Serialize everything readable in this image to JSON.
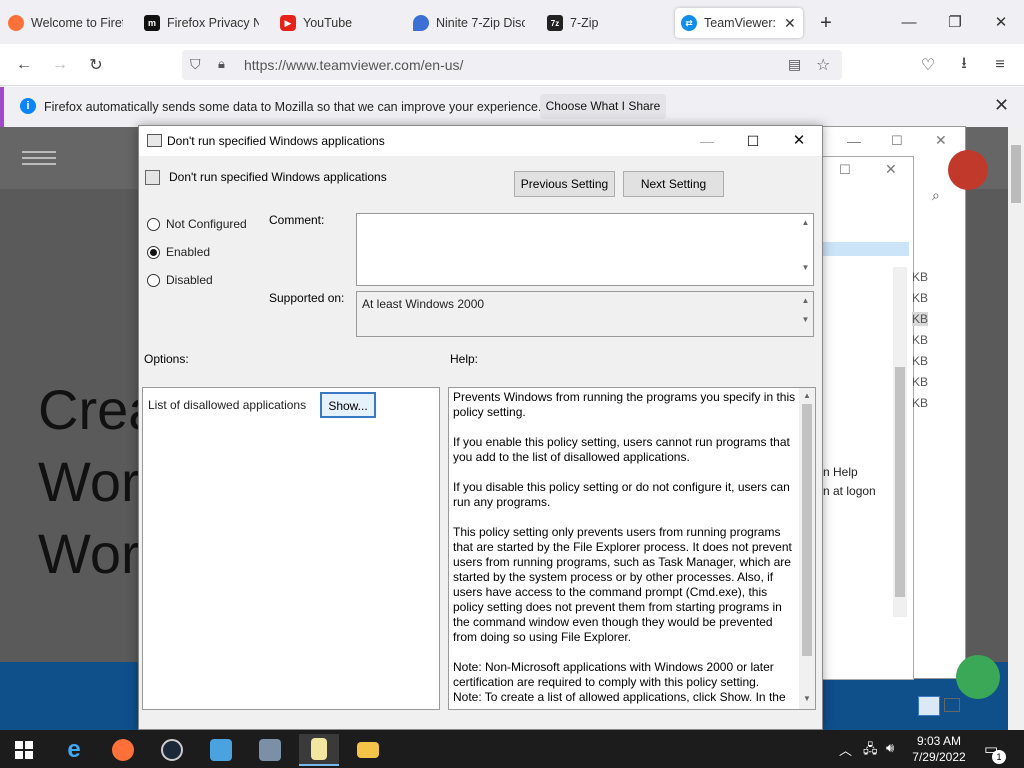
{
  "browser": {
    "tabs": [
      {
        "label": "Welcome to Firef"
      },
      {
        "label": "Firefox Privacy N"
      },
      {
        "label": "YouTube"
      },
      {
        "label": "Ninite 7-Zip Disc"
      },
      {
        "label": "7-Zip"
      },
      {
        "label": "TeamViewer: T"
      }
    ],
    "new_tab": "+",
    "url": "https://www.teamviewer.com/en-us/",
    "notification": {
      "message": "Firefox automatically sends some data to Mozilla so that we can improve your experience.",
      "button": "Choose What I Share"
    }
  },
  "webpage": {
    "hero_lines": [
      "Crea",
      "Wor",
      "Wor"
    ]
  },
  "background_window": {
    "sizes": [
      "KB",
      "KB",
      "KB",
      "KB",
      "KB",
      "KB",
      "KB"
    ],
    "options": [
      "n Help",
      "n at logon"
    ]
  },
  "dialog": {
    "title": "Don't run specified Windows applications",
    "policy_name": "Don't run specified Windows applications",
    "previous_button": "Previous Setting",
    "next_button": "Next Setting",
    "radio": {
      "not_configured": "Not Configured",
      "enabled": "Enabled",
      "disabled": "Disabled"
    },
    "selected_state": "Enabled",
    "comment_label": "Comment:",
    "comment_value": "",
    "supported_label": "Supported on:",
    "supported_value": "At least Windows 2000",
    "options_label": "Options:",
    "help_label": "Help:",
    "option_item": "List of disallowed applications",
    "show_button": "Show...",
    "help_text": "Prevents Windows from running the programs you specify in this policy setting.\n\nIf you enable this policy setting, users cannot run programs that you add to the list of disallowed applications.\n\nIf you disable this policy setting or do not configure it, users can run any programs.\n\nThis policy setting only prevents users from running programs that are started by the File Explorer process. It does not prevent users from running programs, such as Task Manager, which are started by the system process or by other processes.  Also, if users have access to the command prompt (Cmd.exe), this policy setting does not prevent them from starting programs in the command window even though they would be prevented from doing so using File Explorer.\n\nNote: Non-Microsoft applications with Windows 2000 or later certification are required to comply with this policy setting.\nNote: To create a list of allowed applications, click Show.  In the"
  },
  "taskbar": {
    "time": "9:03 AM",
    "date": "7/29/2022",
    "notification_count": "1"
  },
  "colors": {
    "firefox_notification_bar": "#a347cc",
    "taskbar": "#1c1c1c",
    "page_footer": "#0f4f8a"
  }
}
